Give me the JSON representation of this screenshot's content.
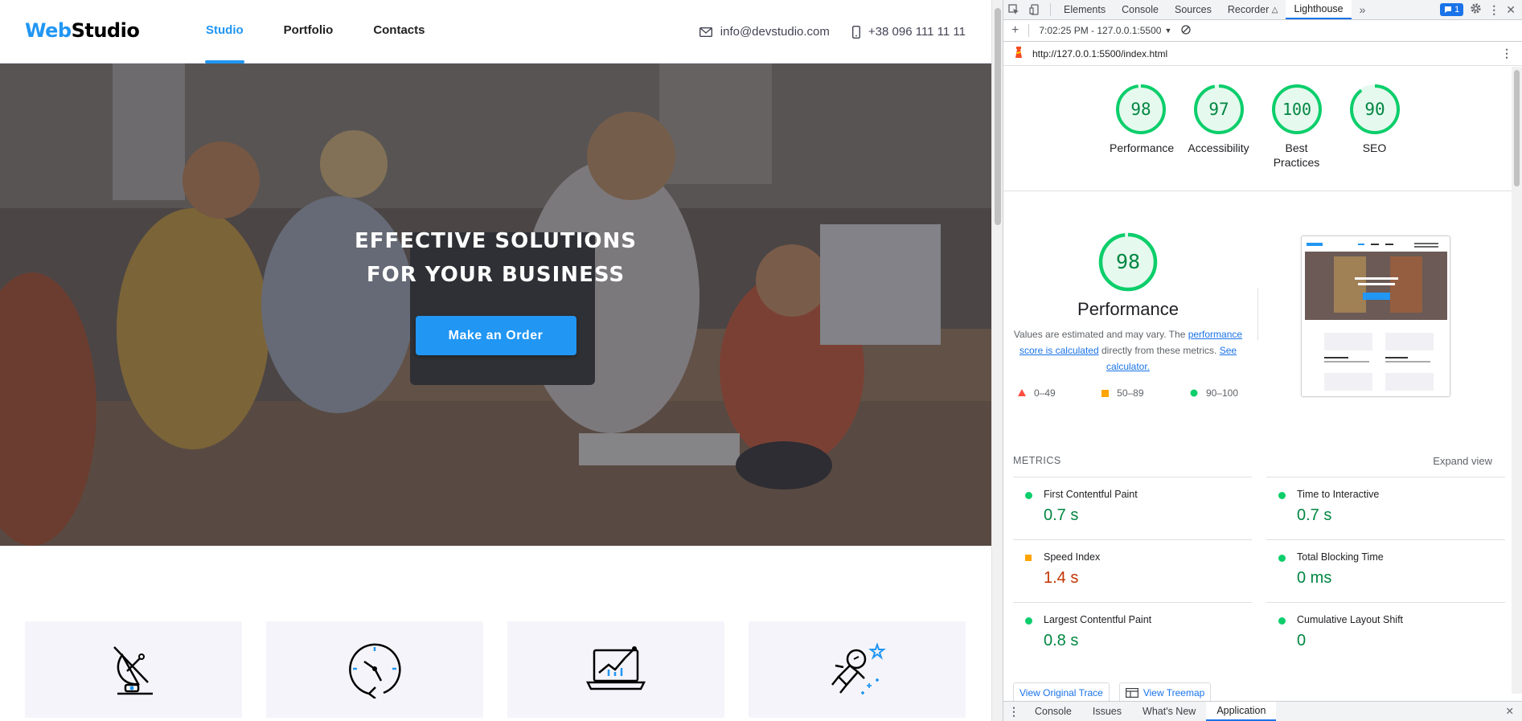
{
  "site": {
    "logo_part1": "Web",
    "logo_part2": "Studio",
    "nav": [
      {
        "label": "Studio"
      },
      {
        "label": "Portfolio"
      },
      {
        "label": "Contacts"
      }
    ],
    "email": "info@devstudio.com",
    "phone": "+38 096 111 11 11",
    "hero": {
      "title_line1": "EFFECTIVE SOLUTIONS",
      "title_line2": "FOR YOUR BUSINESS",
      "button": "Make an Order"
    },
    "feature_icons": [
      "antenna-icon",
      "clock-icon",
      "laptop-chart-icon",
      "astronaut-icon"
    ]
  },
  "devtools": {
    "tabs": [
      {
        "label": "Elements"
      },
      {
        "label": "Console"
      },
      {
        "label": "Sources"
      },
      {
        "label": "Recorder"
      },
      {
        "label": "Lighthouse"
      }
    ],
    "issues_count": "1",
    "report_selector": "7:02:25 PM - 127.0.0.1:5500",
    "url": "http://127.0.0.1:5500/index.html",
    "scores": [
      {
        "label": "Performance",
        "value": "98"
      },
      {
        "label": "Accessibility",
        "value": "97"
      },
      {
        "label": "Best Practices",
        "value": "100"
      },
      {
        "label": "SEO",
        "value": "90"
      }
    ],
    "performance": {
      "score": "98",
      "title": "Performance",
      "desc_prefix": "Values are estimated and may vary. The ",
      "desc_link1": "performance score is calculated",
      "desc_middle": " directly from these metrics. ",
      "desc_link2": "See calculator.",
      "legend": [
        "0–49",
        "50–89",
        "90–100"
      ]
    },
    "metrics_title": "METRICS",
    "expand_view": "Expand view",
    "metrics": [
      {
        "name": "First Contentful Paint",
        "value": "0.7 s",
        "status": "good"
      },
      {
        "name": "Time to Interactive",
        "value": "0.7 s",
        "status": "good"
      },
      {
        "name": "Speed Index",
        "value": "1.4 s",
        "status": "average"
      },
      {
        "name": "Total Blocking Time",
        "value": "0 ms",
        "status": "good"
      },
      {
        "name": "Largest Contentful Paint",
        "value": "0.8 s",
        "status": "good"
      },
      {
        "name": "Cumulative Layout Shift",
        "value": "0",
        "status": "good"
      }
    ],
    "buttons": {
      "original_trace": "View Original Trace",
      "treemap": "View Treemap"
    },
    "drawer_tabs": [
      {
        "label": "Console"
      },
      {
        "label": "Issues"
      },
      {
        "label": "What's New"
      },
      {
        "label": "Application"
      }
    ],
    "colors": {
      "good": "#0cce6b",
      "average": "#ffa400",
      "fail": "#ff4e42",
      "accent": "#2196f3"
    }
  }
}
